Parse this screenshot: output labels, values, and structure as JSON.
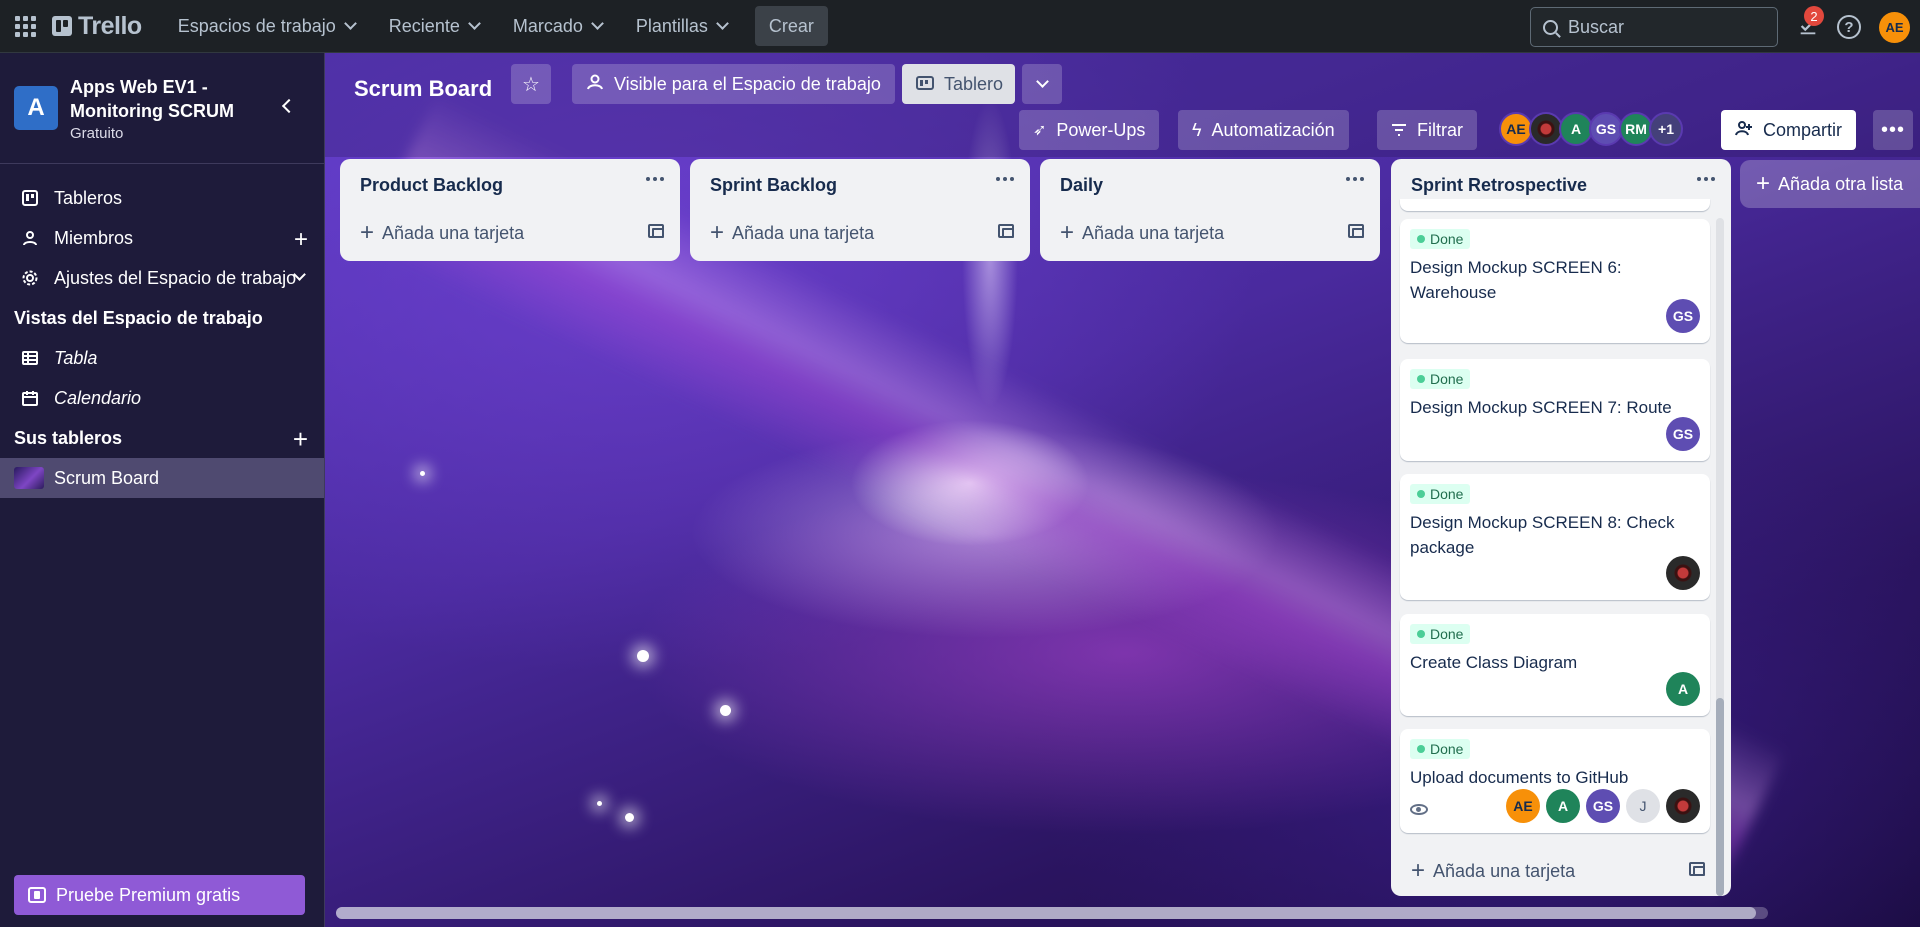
{
  "topnav": {
    "logo": "Trello",
    "menu": [
      {
        "label": "Espacios de trabajo"
      },
      {
        "label": "Reciente"
      },
      {
        "label": "Marcado"
      },
      {
        "label": "Plantillas"
      }
    ],
    "create_label": "Crear",
    "search_placeholder": "Buscar",
    "notification_count": "2",
    "user_initials": "AE"
  },
  "sidebar": {
    "workspace_letter": "A",
    "workspace_name": "Apps Web EV1 - Monitoring SCRUM",
    "workspace_plan": "Gratuito",
    "items": [
      {
        "label": "Tableros",
        "icon": "trello-icon"
      },
      {
        "label": "Miembros",
        "icon": "user-icon"
      },
      {
        "label": "Ajustes del Espacio de trabajo",
        "icon": "gear-icon"
      }
    ],
    "views_title": "Vistas del Espacio de trabajo",
    "views": [
      {
        "label": "Tabla",
        "icon": "table-icon"
      },
      {
        "label": "Calendario",
        "icon": "calendar-icon"
      }
    ],
    "boards_title": "Sus tableros",
    "boards": [
      {
        "label": "Scrum Board"
      }
    ],
    "premium_label": "Pruebe Premium gratis"
  },
  "board": {
    "title": "Scrum Board",
    "visibility_label": "Visible para el Espacio de trabajo",
    "view_label": "Tablero",
    "powerups_label": "Power-Ups",
    "automation_label": "Automatización",
    "filter_label": "Filtrar",
    "members": [
      {
        "initials": "AE",
        "color": "#f79009"
      },
      {
        "initials": "",
        "color": "#2a2a2a"
      },
      {
        "initials": "A",
        "color": "#1f845a"
      },
      {
        "initials": "GS",
        "color": "#5e4db2"
      },
      {
        "initials": "RM",
        "color": "#1f845a"
      }
    ],
    "extra_members": "+1",
    "share_label": "Compartir",
    "add_list_label": "Añada otra lista"
  },
  "lists": [
    {
      "title": "Product Backlog",
      "add_card": "Añada una tarjeta"
    },
    {
      "title": "Sprint Backlog",
      "add_card": "Añada una tarjeta"
    },
    {
      "title": "Daily",
      "add_card": "Añada una tarjeta"
    },
    {
      "title": "Sprint Retrospective",
      "add_card": "Añada una tarjeta"
    }
  ],
  "retro_cards": [
    {
      "label": "Done",
      "title": "Design Mockup SCREEN 6: Warehouse",
      "members": [
        {
          "initials": "GS",
          "color": "#5e4db2"
        }
      ]
    },
    {
      "label": "Done",
      "title": "Design Mockup SCREEN 7: Route",
      "members": [
        {
          "initials": "GS",
          "color": "#5e4db2"
        }
      ]
    },
    {
      "label": "Done",
      "title": "Design Mockup SCREEN 8: Check package",
      "members": [
        {
          "initials": "",
          "color": "#2a2a2a"
        }
      ]
    },
    {
      "label": "Done",
      "title": "Create Class Diagram",
      "members": [
        {
          "initials": "A",
          "color": "#1f845a"
        }
      ]
    },
    {
      "label": "Done",
      "title": "Upload documents to GitHub",
      "members": [
        {
          "initials": "AE",
          "color": "#f79009"
        },
        {
          "initials": "A",
          "color": "#1f845a"
        },
        {
          "initials": "GS",
          "color": "#5e4db2"
        },
        {
          "initials": "J",
          "color": "#dfe1e6"
        },
        {
          "initials": "",
          "color": "#2a2a2a"
        }
      ]
    }
  ]
}
